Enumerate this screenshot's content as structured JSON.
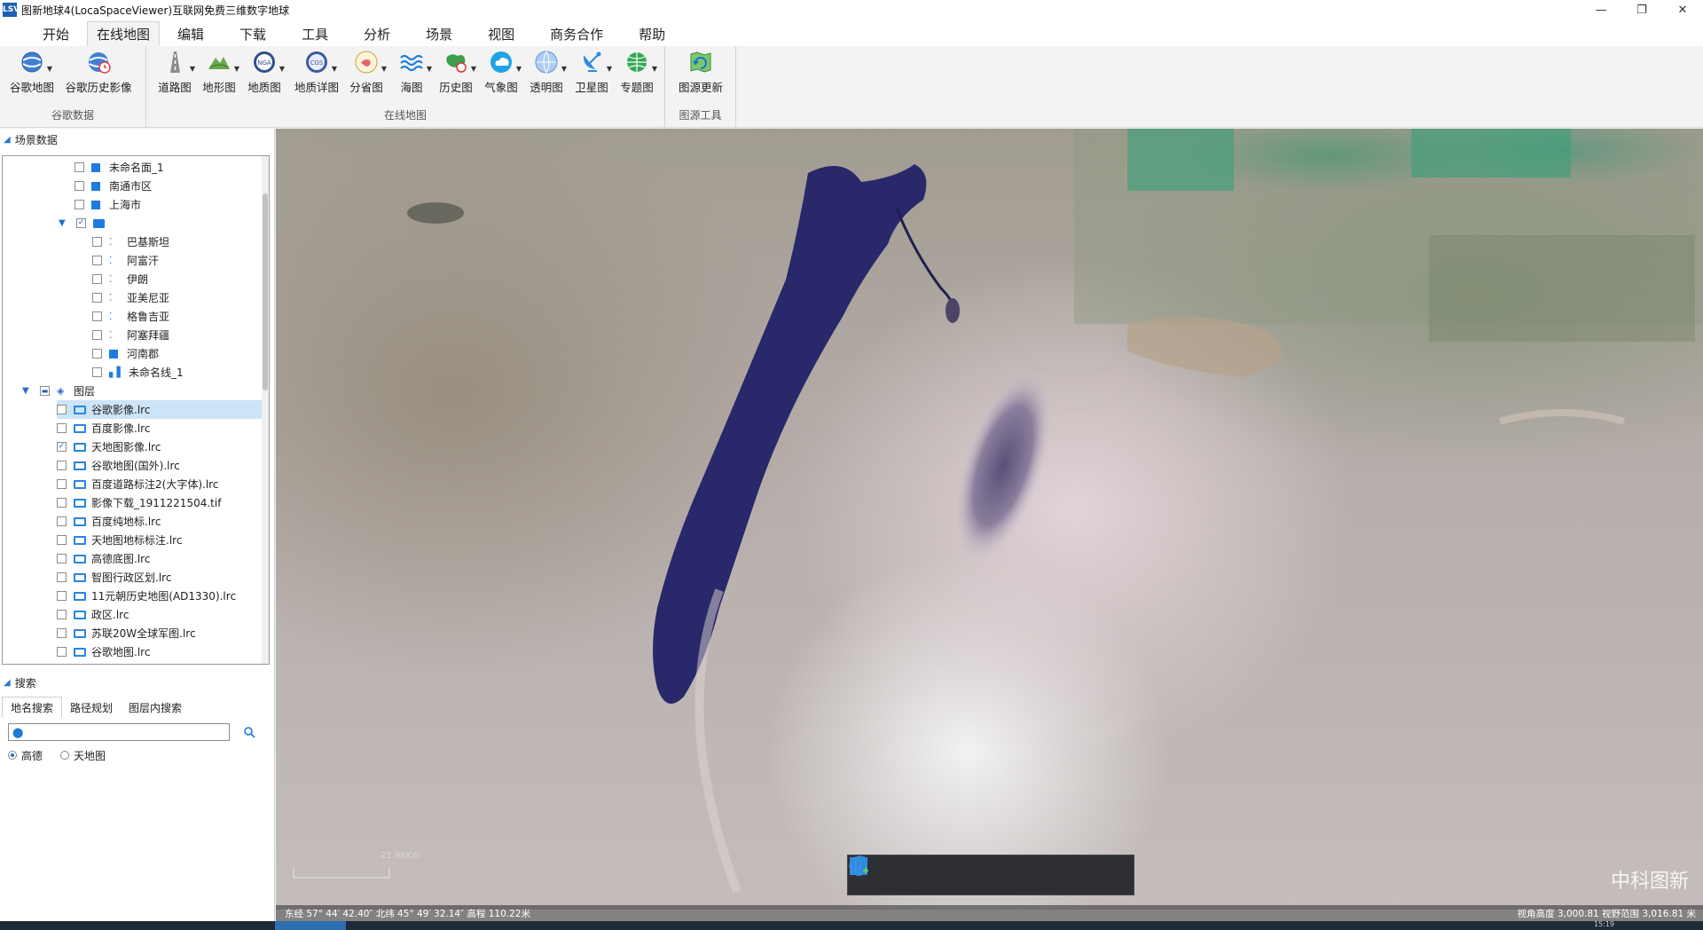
{
  "window": {
    "title": "图新地球4(LocaSpaceViewer)互联网免费三维数字地球",
    "app_icon_text": "LSV",
    "minimize": "—",
    "restore": "❐",
    "close": "✕"
  },
  "menu_tabs": [
    "开始",
    "在线地图",
    "编辑",
    "下载",
    "工具",
    "分析",
    "场景",
    "视图",
    "商务合作",
    "帮助"
  ],
  "ribbon": {
    "groups": [
      {
        "label": "谷歌数据",
        "buttons": [
          "谷歌地图",
          "谷歌历史影像"
        ]
      },
      {
        "label": "在线地图",
        "buttons": [
          "道路图",
          "地形图",
          "地质图",
          "地质详图",
          "分省图",
          "海图",
          "历史图",
          "气象图",
          "透明图",
          "卫星图",
          "专题图"
        ]
      },
      {
        "label": "图源工具",
        "buttons": [
          "图源更新"
        ]
      }
    ],
    "icon_texts": {
      "nga": "NGA",
      "cgs": "CGS"
    }
  },
  "scene_panel": {
    "title": "场景数据",
    "tree_items": [
      {
        "label": "未命名面_1",
        "icon": "polygon-icon",
        "checked": false,
        "level": 3
      },
      {
        "label": "南通市区",
        "icon": "polygon-icon",
        "checked": false,
        "level": 3
      },
      {
        "label": "上海市",
        "icon": "polygon-icon",
        "checked": false,
        "level": 3
      },
      {
        "label": "",
        "icon": "folder-icon",
        "checked": true,
        "level": 2,
        "expanded": true
      },
      {
        "label": "巴基斯坦",
        "icon": "point-icon",
        "checked": false,
        "level": 4
      },
      {
        "label": "阿富汗",
        "icon": "point-icon",
        "checked": false,
        "level": 4
      },
      {
        "label": "伊朗",
        "icon": "point-icon",
        "checked": false,
        "level": 4
      },
      {
        "label": "亚美尼亚",
        "icon": "point-icon",
        "checked": false,
        "level": 4
      },
      {
        "label": "格鲁吉亚",
        "icon": "point-icon",
        "checked": false,
        "level": 4
      },
      {
        "label": "阿塞拜疆",
        "icon": "point-icon",
        "checked": false,
        "level": 4
      },
      {
        "label": "河南郡",
        "icon": "polygon-icon",
        "checked": false,
        "level": 4
      },
      {
        "label": "未命名线_1",
        "icon": "line-icon",
        "checked": false,
        "level": 4
      }
    ],
    "layers_node": {
      "label": "图层"
    },
    "layers": [
      {
        "label": "谷歌影像.lrc",
        "checked": false,
        "selected": true
      },
      {
        "label": "百度影像.lrc",
        "checked": false
      },
      {
        "label": "天地图影像.lrc",
        "checked": true
      },
      {
        "label": "谷歌地图(国外).lrc",
        "checked": false
      },
      {
        "label": "百度道路标注2(大字体).lrc",
        "checked": false
      },
      {
        "label": "影像下载_1911221504.tif",
        "checked": false
      },
      {
        "label": "百度纯地标.lrc",
        "checked": false
      },
      {
        "label": "天地图地标标注.lrc",
        "checked": false
      },
      {
        "label": "高德底图.lrc",
        "checked": false
      },
      {
        "label": "智图行政区划.lrc",
        "checked": false
      },
      {
        "label": "11元朝历史地图(AD1330).lrc",
        "checked": false
      },
      {
        "label": "政区.lrc",
        "checked": false
      },
      {
        "label": "苏联20W全球军图.lrc",
        "checked": false
      },
      {
        "label": "谷歌地图.lrc",
        "checked": false
      }
    ]
  },
  "search_panel": {
    "title": "搜索",
    "tabs": [
      "地名搜索",
      "路径规划",
      "图层内搜索"
    ],
    "input_value": "",
    "input_placeholder": "",
    "sources": [
      {
        "label": "高德",
        "selected": true
      },
      {
        "label": "天地图",
        "selected": false
      }
    ]
  },
  "map": {
    "watermark": "中科图新",
    "scale_text": "21.96Km",
    "status_left": "东经 57° 44′ 42.40″ 北纬 45° 49′ 32.14″ 高程 110.22米",
    "status_right": "视角高度 3,000.81 视野范围 3,016.81 米",
    "toolbar": [
      "pan-tool",
      "select-tool",
      "place-marker-tool",
      "draw-line-tool",
      "draw-polygon-tool",
      "chart-tool"
    ],
    "water_color": "#28286a",
    "accent": "#1e78d7"
  },
  "taskbar": {
    "time": "15:19"
  }
}
